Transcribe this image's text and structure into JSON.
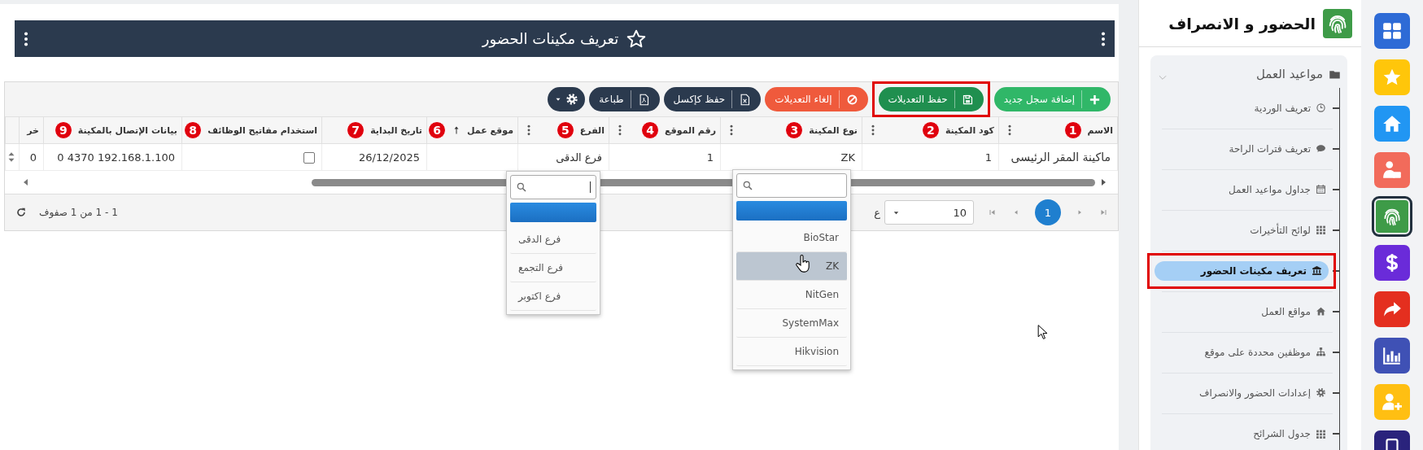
{
  "icon_rail": [
    {
      "kind": "dashboard",
      "color": "#2e6bd6",
      "selected": false
    },
    {
      "kind": "star",
      "color": "#ffc60a",
      "selected": false
    },
    {
      "kind": "home",
      "color": "#2196f3",
      "selected": false
    },
    {
      "kind": "employee",
      "color": "#f26b5b",
      "selected": false
    },
    {
      "kind": "fingerprint",
      "color": "#3e9b48",
      "selected": true
    },
    {
      "kind": "dollar",
      "color": "#6a2bd9",
      "selected": false
    },
    {
      "kind": "share",
      "color": "#e42f1f",
      "selected": false
    },
    {
      "kind": "chart",
      "color": "#3f51b5",
      "selected": false
    },
    {
      "kind": "user-add",
      "color": "#ffbf12",
      "selected": false
    },
    {
      "kind": "phone",
      "color": "#2a237c",
      "selected": false
    }
  ],
  "sidebar": {
    "title": "الحضور و الانصراف",
    "group": {
      "title": "مواعيد العمل",
      "expanded": true,
      "items": [
        {
          "kind": "clock",
          "label": "تعريف الوردية",
          "selected": false,
          "highlighted": false
        },
        {
          "kind": "comment",
          "label": "تعريف فترات الراحة",
          "selected": false,
          "highlighted": false
        },
        {
          "kind": "calendar",
          "label": "جداول مواعيد العمل",
          "selected": false,
          "highlighted": false
        },
        {
          "kind": "grid",
          "label": "لوائح التأخيرات",
          "selected": false,
          "highlighted": false
        },
        {
          "kind": "bank",
          "label": "تعريف مكينات الحضور",
          "selected": true,
          "highlighted": true
        },
        {
          "kind": "home",
          "label": "مواقع العمل",
          "selected": false,
          "highlighted": false
        },
        {
          "kind": "sitemap",
          "label": "موظفين محددة على موقع",
          "selected": false,
          "highlighted": false
        },
        {
          "kind": "gear",
          "label": "إعدادات الحضور والانصراف",
          "selected": false,
          "highlighted": false
        },
        {
          "kind": "grid",
          "label": "جدول الشرائح",
          "selected": false,
          "highlighted": false
        }
      ]
    }
  },
  "header": {
    "title": "تعريف مكينات الحضور"
  },
  "toolbar": {
    "buttons": [
      {
        "kind": "add",
        "label": "إضافة سجل جديد",
        "highlighted": false
      },
      {
        "kind": "save",
        "label": "حفظ التعديلات",
        "highlighted": true
      },
      {
        "kind": "cancel",
        "label": "إلغاء التعديلات",
        "highlighted": false
      },
      {
        "kind": "excel",
        "label": "حفظ كإكسل",
        "highlighted": false
      },
      {
        "kind": "pdf",
        "label": "طباعة",
        "highlighted": false
      },
      {
        "kind": "settings",
        "highlighted": false
      }
    ]
  },
  "table": {
    "columns": [
      {
        "label": "الاسم",
        "badge": "1",
        "menu": true,
        "sorted": false
      },
      {
        "label": "كود المكينة",
        "badge": "2",
        "menu": true,
        "sorted": false
      },
      {
        "label": "نوع المكينة",
        "badge": "3",
        "menu": true,
        "sorted": false
      },
      {
        "label": "رقم الموقع",
        "badge": "4",
        "menu": true,
        "sorted": false
      },
      {
        "label": "الفرع",
        "badge": "5",
        "menu": true,
        "sorted": false
      },
      {
        "label": "موقع عمل",
        "badge": "6",
        "menu": false,
        "sorted": true
      },
      {
        "label": "تاريخ البداية",
        "badge": "7",
        "menu": false,
        "sorted": false
      },
      {
        "label": "استخدام مفاتيح الوظائف",
        "badge": "8",
        "menu": false,
        "sorted": false
      },
      {
        "label": "بيانات الإتصال بالمكينة",
        "badge": "9",
        "menu": false,
        "sorted": false
      },
      {
        "label": "خر",
        "menu": false,
        "sorted": false
      }
    ],
    "rows": [
      {
        "cells": [
          {
            "kind": "text",
            "text": "ماكينة المقر الرئيسى"
          },
          {
            "kind": "text",
            "text": "1"
          },
          {
            "kind": "text",
            "text": "ZK"
          },
          {
            "kind": "text",
            "text": "1"
          },
          {
            "kind": "text",
            "text": "فرع الدقى"
          },
          {
            "kind": "empty"
          },
          {
            "kind": "text",
            "text": "26/12/2025"
          },
          {
            "kind": "checkbox",
            "checked": false
          },
          {
            "kind": "text",
            "text": "0 4370 192.168.1.100"
          },
          {
            "kind": "text",
            "text": "0"
          }
        ]
      }
    ]
  },
  "pager": {
    "pages": [
      {
        "label": "1",
        "selected": true
      }
    ],
    "page_size": "10",
    "page_size_label": "ع",
    "summary": "1 - 1 من 1 صفوف"
  },
  "dropdowns": [
    {
      "search_caret": false,
      "blank_selected": true,
      "options": [
        {
          "label": "BioStar",
          "hovered": false
        },
        {
          "label": "ZK",
          "hovered": true
        },
        {
          "label": "NitGen",
          "hovered": false
        },
        {
          "label": "SystemMax",
          "hovered": false
        },
        {
          "label": "Hikvision",
          "hovered": false
        }
      ]
    },
    {
      "search_caret": true,
      "blank_selected": true,
      "options": [
        {
          "label": "فرع الدقى",
          "hovered": false
        },
        {
          "label": "فرع التجمع",
          "hovered": false
        },
        {
          "label": "فرع اكتوبر",
          "hovered": false
        }
      ]
    }
  ]
}
